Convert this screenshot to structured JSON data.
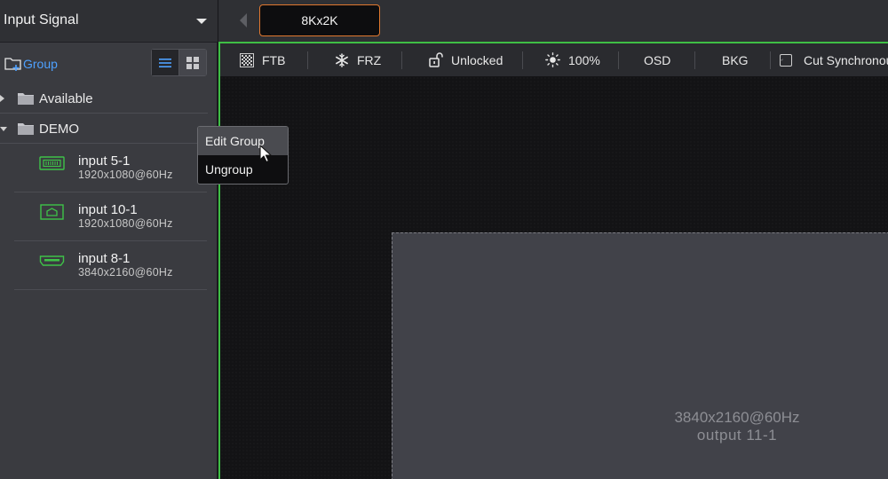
{
  "panel": {
    "title": "Input Signal",
    "add_group_label": "Group"
  },
  "tree": {
    "groups": [
      {
        "label": "Available",
        "expanded": false
      },
      {
        "label": "DEMO",
        "expanded": true
      }
    ],
    "inputs": [
      {
        "name": "input 5-1",
        "resolution": "1920x1080@60Hz",
        "icon": "dvi-port-icon"
      },
      {
        "name": "input 10-1",
        "resolution": "1920x1080@60Hz",
        "icon": "displayport-icon"
      },
      {
        "name": "input 8-1",
        "resolution": "3840x2160@60Hz",
        "icon": "hdmi-port-icon"
      }
    ]
  },
  "context_menu": {
    "items": [
      "Edit Group",
      "Ungroup"
    ]
  },
  "screen_tab": {
    "label": "8Kx2K"
  },
  "toolbar": {
    "ftb": "FTB",
    "frz": "FRZ",
    "lock": "Unlocked",
    "brightness": "100%",
    "osd": "OSD",
    "bkg": "BKG",
    "cut_sync": "Cut Synchronou",
    "cut_sync_checked": true
  },
  "output": {
    "resolution": "3840x2160@60Hz",
    "name": "output 11-1"
  },
  "colors": {
    "accent_blue": "#4ea1ff",
    "active_border_green": "#3fbf45",
    "tab_border_orange": "#e0782f",
    "port_icon_green": "#3ec248"
  }
}
